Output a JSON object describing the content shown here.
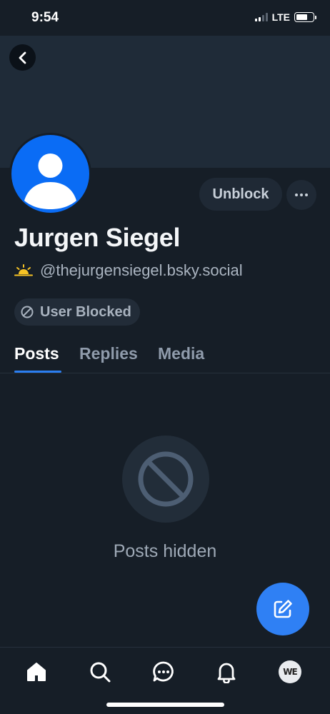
{
  "status_bar": {
    "time": "9:54",
    "network": "LTE",
    "signal_bars": 2,
    "battery_level": 0.7
  },
  "header": {
    "back_icon": "chevron-left-icon"
  },
  "profile": {
    "display_name": "Jurgen Siegel",
    "handle": "@thejurgensiegel.bsky.social",
    "handle_emoji": "🌅",
    "avatar_color": "#0a6cf5",
    "unblock_label": "Unblock",
    "more_icon": "ellipsis-icon",
    "blocked_badge": "User Blocked"
  },
  "tabs": [
    {
      "label": "Posts",
      "active": true
    },
    {
      "label": "Replies",
      "active": false
    },
    {
      "label": "Media",
      "active": false
    }
  ],
  "content": {
    "hidden_icon": "block-icon",
    "hidden_message": "Posts hidden"
  },
  "fab": {
    "icon": "compose-icon",
    "color": "#2f80f4"
  },
  "bottom_nav": {
    "items": [
      "home-icon",
      "search-icon",
      "chat-icon",
      "bell-icon",
      "profile-avatar"
    ],
    "avatar_text": "WE"
  },
  "colors": {
    "background": "#161e27",
    "banner": "#1f2b38",
    "accent": "#2b7ef0"
  }
}
